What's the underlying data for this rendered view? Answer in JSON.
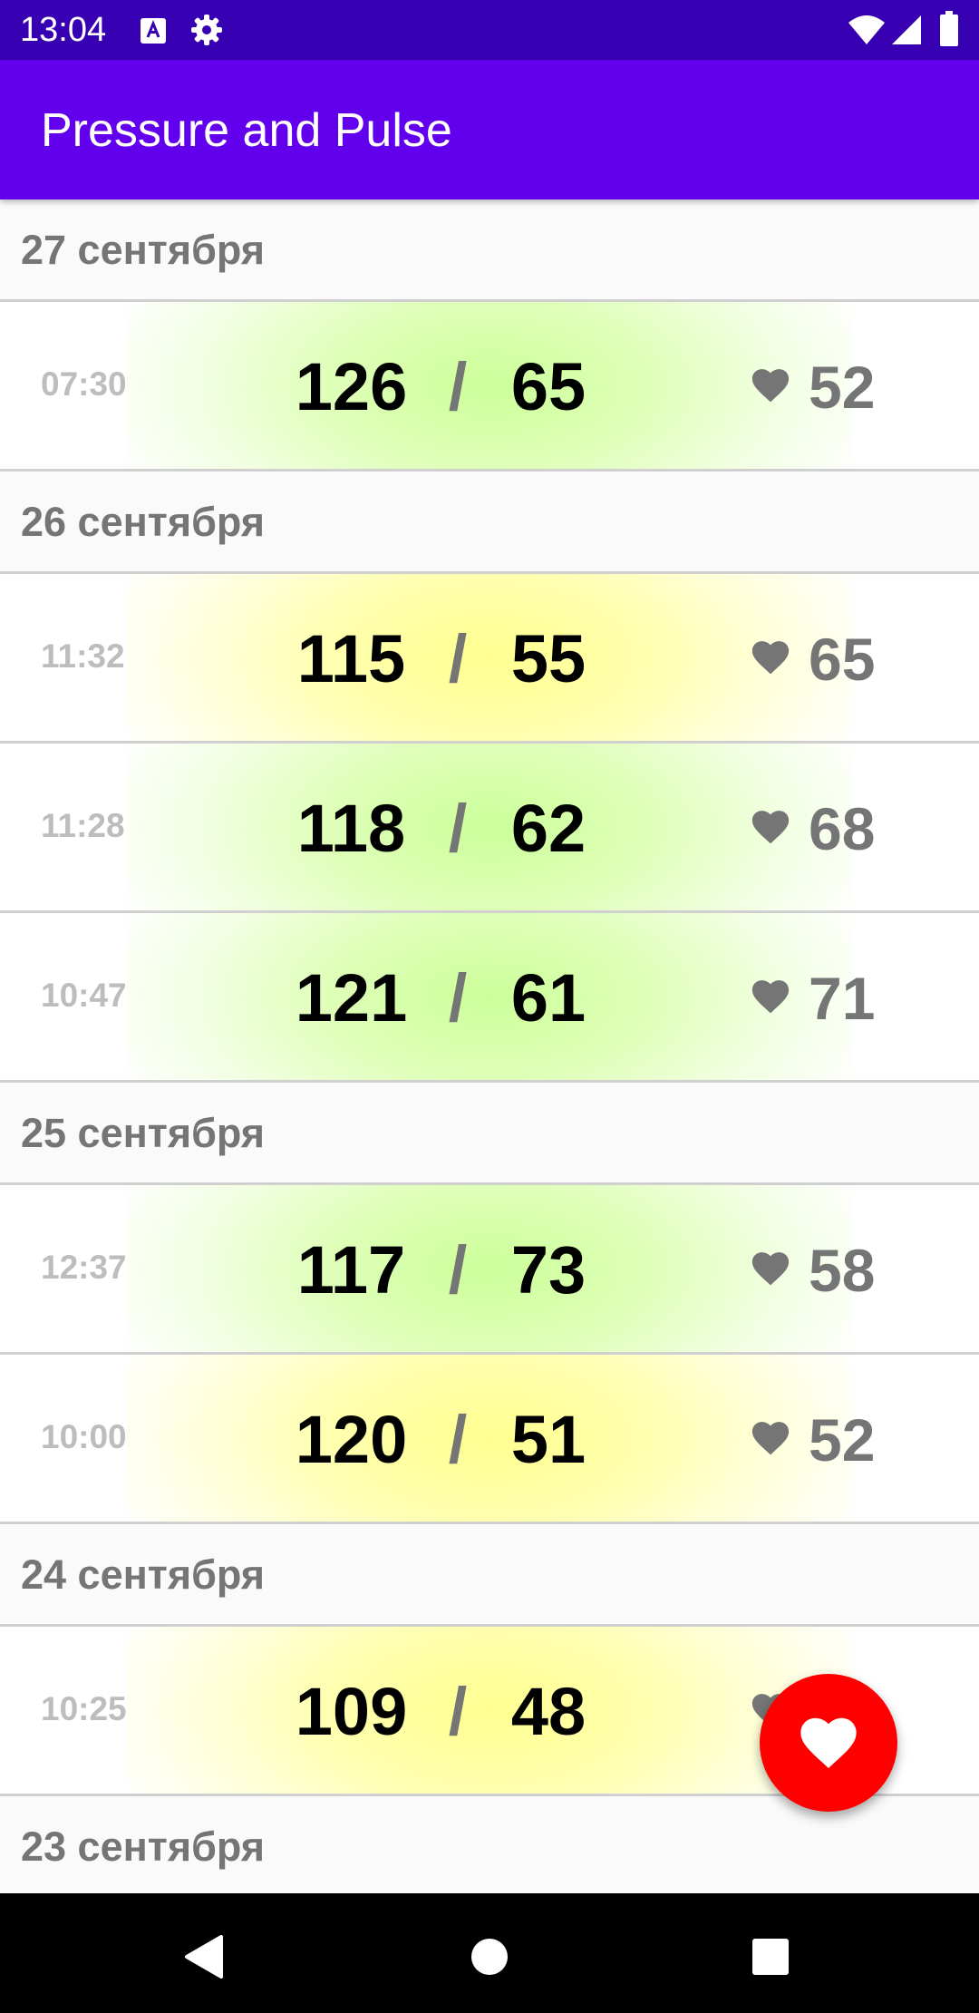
{
  "status_bar": {
    "time": "13:04",
    "icons": [
      "keyboard-a-icon",
      "gear-icon",
      "wifi-icon",
      "signal-icon",
      "battery-icon"
    ],
    "background": "#3700b3"
  },
  "app_bar": {
    "title": "Pressure and Pulse",
    "background": "#6200ee"
  },
  "groups": [
    {
      "date": "27 сентября",
      "entries": [
        {
          "time": "07:30",
          "systolic": "126",
          "diastolic": "65",
          "pulse": "52",
          "highlight": "green"
        }
      ]
    },
    {
      "date": "26 сентября",
      "entries": [
        {
          "time": "11:32",
          "systolic": "115",
          "diastolic": "55",
          "pulse": "65",
          "highlight": "yellow"
        },
        {
          "time": "11:28",
          "systolic": "118",
          "diastolic": "62",
          "pulse": "68",
          "highlight": "green"
        },
        {
          "time": "10:47",
          "systolic": "121",
          "diastolic": "61",
          "pulse": "71",
          "highlight": "green"
        }
      ]
    },
    {
      "date": "25 сентября",
      "entries": [
        {
          "time": "12:37",
          "systolic": "117",
          "diastolic": "73",
          "pulse": "58",
          "highlight": "green"
        },
        {
          "time": "10:00",
          "systolic": "120",
          "diastolic": "51",
          "pulse": "52",
          "highlight": "yellow"
        }
      ]
    },
    {
      "date": "24 сентября",
      "entries": [
        {
          "time": "10:25",
          "systolic": "109",
          "diastolic": "48",
          "pulse": "",
          "highlight": "yellow"
        }
      ]
    },
    {
      "date": "23 сентября",
      "entries": []
    }
  ],
  "separator": "/",
  "fab": {
    "icon": "heart-icon",
    "color": "#ff0000"
  },
  "nav_bar": {
    "icons": [
      "back-icon",
      "home-icon",
      "recents-icon"
    ]
  },
  "colors": {
    "green_glow": "#ccff99",
    "yellow_glow": "#ffff90",
    "accent": "#6200ee",
    "status": "#3700b3"
  }
}
